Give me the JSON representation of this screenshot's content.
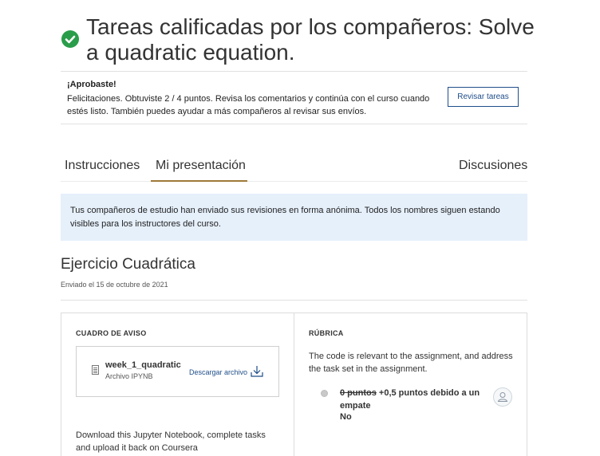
{
  "header": {
    "title": "Tareas calificadas por los compañeros: Solve a quadratic equation.",
    "status_icon": "check-circle-icon",
    "status_color": "#2a9d4a"
  },
  "banner": {
    "heading": "¡Aprobaste!",
    "message": "Felicitaciones. Obtuviste 2 / 4 puntos. Revisa los comentarios y continúa con el curso cuando estés listo. También puedes ayudar a más compañeros al revisar sus envíos.",
    "button_label": "Revisar tareas"
  },
  "tabs": {
    "instructions": "Instrucciones",
    "my_submission": "Mi presentación",
    "discussions": "Discusiones",
    "active": "Mi presentación",
    "active_color": "#9e7a38"
  },
  "notice": {
    "text": "Tus compañeros de estudio han enviado sus revisiones en forma anónima. Todos los nombres siguen estando visibles para los instructores del curso."
  },
  "submission": {
    "title": "Ejercicio Cuadrática",
    "submitted": "Enviado el 15 de octubre de 2021"
  },
  "left_panel": {
    "label": "CUADRO DE AVISO",
    "file_name": "week_1_quadratic",
    "file_type": "Archivo IPYNB",
    "download_label": "Descargar archivo",
    "description": "Download this Jupyter Notebook, complete tasks and upload it back on Coursera"
  },
  "rubric": {
    "label": "RÚBRICA",
    "criterion": "The code is relevant to the assignment, and address the task set in the assignment.",
    "points_struck": "0 puntos",
    "points_text": "+0,5 puntos debido a un empate",
    "answer": "No"
  }
}
